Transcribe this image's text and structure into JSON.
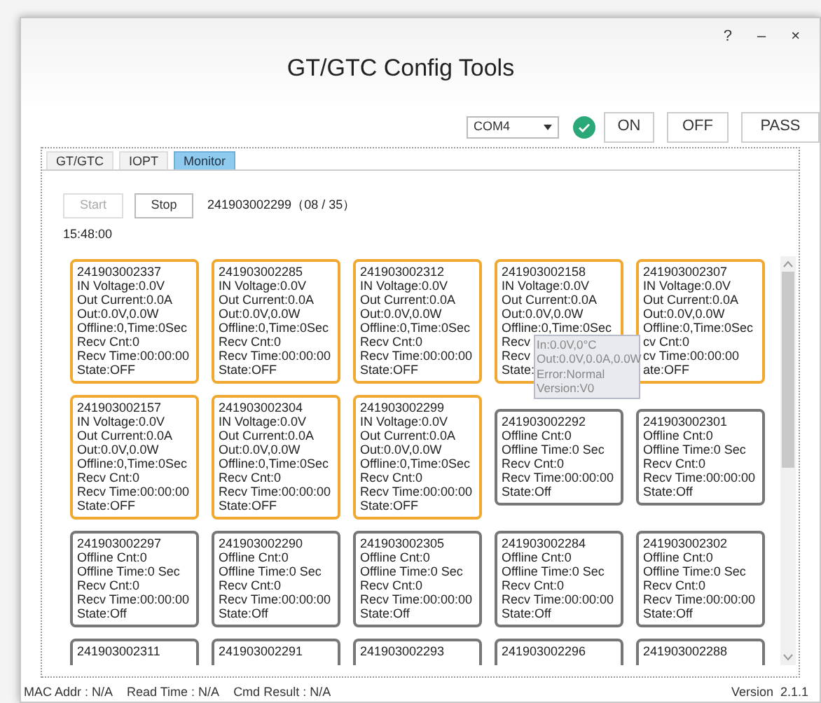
{
  "window": {
    "title": "GT/GTC Config Tools",
    "controls": [
      "?",
      "–",
      "×"
    ]
  },
  "toolbar": {
    "port": "COM4",
    "connected": true,
    "buttons": [
      "ON",
      "OFF",
      "PASS"
    ]
  },
  "tabs": [
    {
      "label": "GT/GTC",
      "selected": false
    },
    {
      "label": "IOPT",
      "selected": false
    },
    {
      "label": "Monitor",
      "selected": true
    }
  ],
  "monitor": {
    "start": {
      "label": "Start",
      "disabled": true
    },
    "stop": {
      "label": "Stop",
      "disabled": false
    },
    "current": "241903002299（08 / 35）",
    "time": "15:48:00",
    "cards": [
      {
        "kind": "online",
        "lines": [
          "241903002337",
          "IN Voltage:0.0V",
          "Out Current:0.0A",
          "Out:0.0V,0.0W",
          "Offline:0,Time:0Sec",
          "Recv Cnt:0",
          "Recv Time:00:00:00",
          "State:OFF"
        ]
      },
      {
        "kind": "online",
        "lines": [
          "241903002285",
          "IN Voltage:0.0V",
          "Out Current:0.0A",
          "Out:0.0V,0.0W",
          "Offline:0,Time:0Sec",
          "Recv Cnt:0",
          "Recv Time:00:00:00",
          "State:OFF"
        ]
      },
      {
        "kind": "online",
        "lines": [
          "241903002312",
          "IN Voltage:0.0V",
          "Out Current:0.0A",
          "Out:0.0V,0.0W",
          "Offline:0,Time:0Sec",
          "Recv Cnt:0",
          "Recv Time:00:00:00",
          "State:OFF"
        ]
      },
      {
        "kind": "online",
        "lines": [
          "241903002158",
          "IN Voltage:0.0V",
          "Out Current:0.0A",
          "Out:0.0V,0.0W",
          "Offline:0,Time:0Sec",
          "Recv",
          "Recv",
          "State:"
        ],
        "tooltip": [
          "In:0.0V,0°C",
          "Out:0.0V,0.0A,0.0W",
          "Error:Normal",
          "Version:V0"
        ]
      },
      {
        "kind": "online",
        "lines": [
          "241903002307",
          "IN Voltage:0.0V",
          "Out Current:0.0A",
          "Out:0.0V,0.0W",
          "Offline:0,Time:0Sec",
          "cv Cnt:0",
          "cv Time:00:00:00",
          "ate:OFF"
        ]
      },
      {
        "kind": "online",
        "lines": [
          "241903002157",
          "IN Voltage:0.0V",
          "Out Current:0.0A",
          "Out:0.0V,0.0W",
          "Offline:0,Time:0Sec",
          "Recv Cnt:0",
          "Recv Time:00:00:00",
          "State:OFF"
        ]
      },
      {
        "kind": "online",
        "lines": [
          "241903002304",
          "IN Voltage:0.0V",
          "Out Current:0.0A",
          "Out:0.0V,0.0W",
          "Offline:0,Time:0Sec",
          "Recv Cnt:0",
          "Recv Time:00:00:00",
          "State:OFF"
        ]
      },
      {
        "kind": "online",
        "lines": [
          "241903002299",
          "IN Voltage:0.0V",
          "Out Current:0.0A",
          "Out:0.0V,0.0W",
          "Offline:0,Time:0Sec",
          "Recv Cnt:0",
          "Recv Time:00:00:00",
          "State:OFF"
        ]
      },
      {
        "kind": "offline",
        "lines": [
          "241903002292",
          "Offline Cnt:0",
          "Offline Time:0 Sec",
          "Recv Cnt:0",
          "Recv Time:00:00:00",
          "State:Off"
        ]
      },
      {
        "kind": "offline",
        "lines": [
          "241903002301",
          "Offline Cnt:0",
          "Offline Time:0 Sec",
          "Recv Cnt:0",
          "Recv Time:00:00:00",
          "State:Off"
        ]
      },
      {
        "kind": "offline",
        "lines": [
          "241903002297",
          "Offline Cnt:0",
          "Offline Time:0 Sec",
          "Recv Cnt:0",
          "Recv Time:00:00:00",
          "State:Off"
        ]
      },
      {
        "kind": "offline",
        "lines": [
          "241903002290",
          "Offline Cnt:0",
          "Offline Time:0 Sec",
          "Recv Cnt:0",
          "Recv Time:00:00:00",
          "State:Off"
        ]
      },
      {
        "kind": "offline",
        "lines": [
          "241903002305",
          "Offline Cnt:0",
          "Offline Time:0 Sec",
          "Recv Cnt:0",
          "Recv Time:00:00:00",
          "State:Off"
        ]
      },
      {
        "kind": "offline",
        "lines": [
          "241903002284",
          "Offline Cnt:0",
          "Offline Time:0 Sec",
          "Recv Cnt:0",
          "Recv Time:00:00:00",
          "State:Off"
        ]
      },
      {
        "kind": "offline",
        "lines": [
          "241903002302",
          "Offline Cnt:0",
          "Offline Time:0 Sec",
          "Recv Cnt:0",
          "Recv Time:00:00:00",
          "State:Off"
        ]
      },
      {
        "kind": "offline",
        "lines": [
          "241903002311"
        ]
      },
      {
        "kind": "offline",
        "lines": [
          "241903002291"
        ]
      },
      {
        "kind": "offline",
        "lines": [
          "241903002293"
        ]
      },
      {
        "kind": "offline",
        "lines": [
          "241903002296"
        ]
      },
      {
        "kind": "offline",
        "lines": [
          "241903002288"
        ]
      }
    ]
  },
  "status_bar": {
    "items": [
      "MAC Addr : N/A",
      "Read Time : N/A",
      "Cmd Result : N/A"
    ],
    "version": "Version  2.1.1"
  }
}
